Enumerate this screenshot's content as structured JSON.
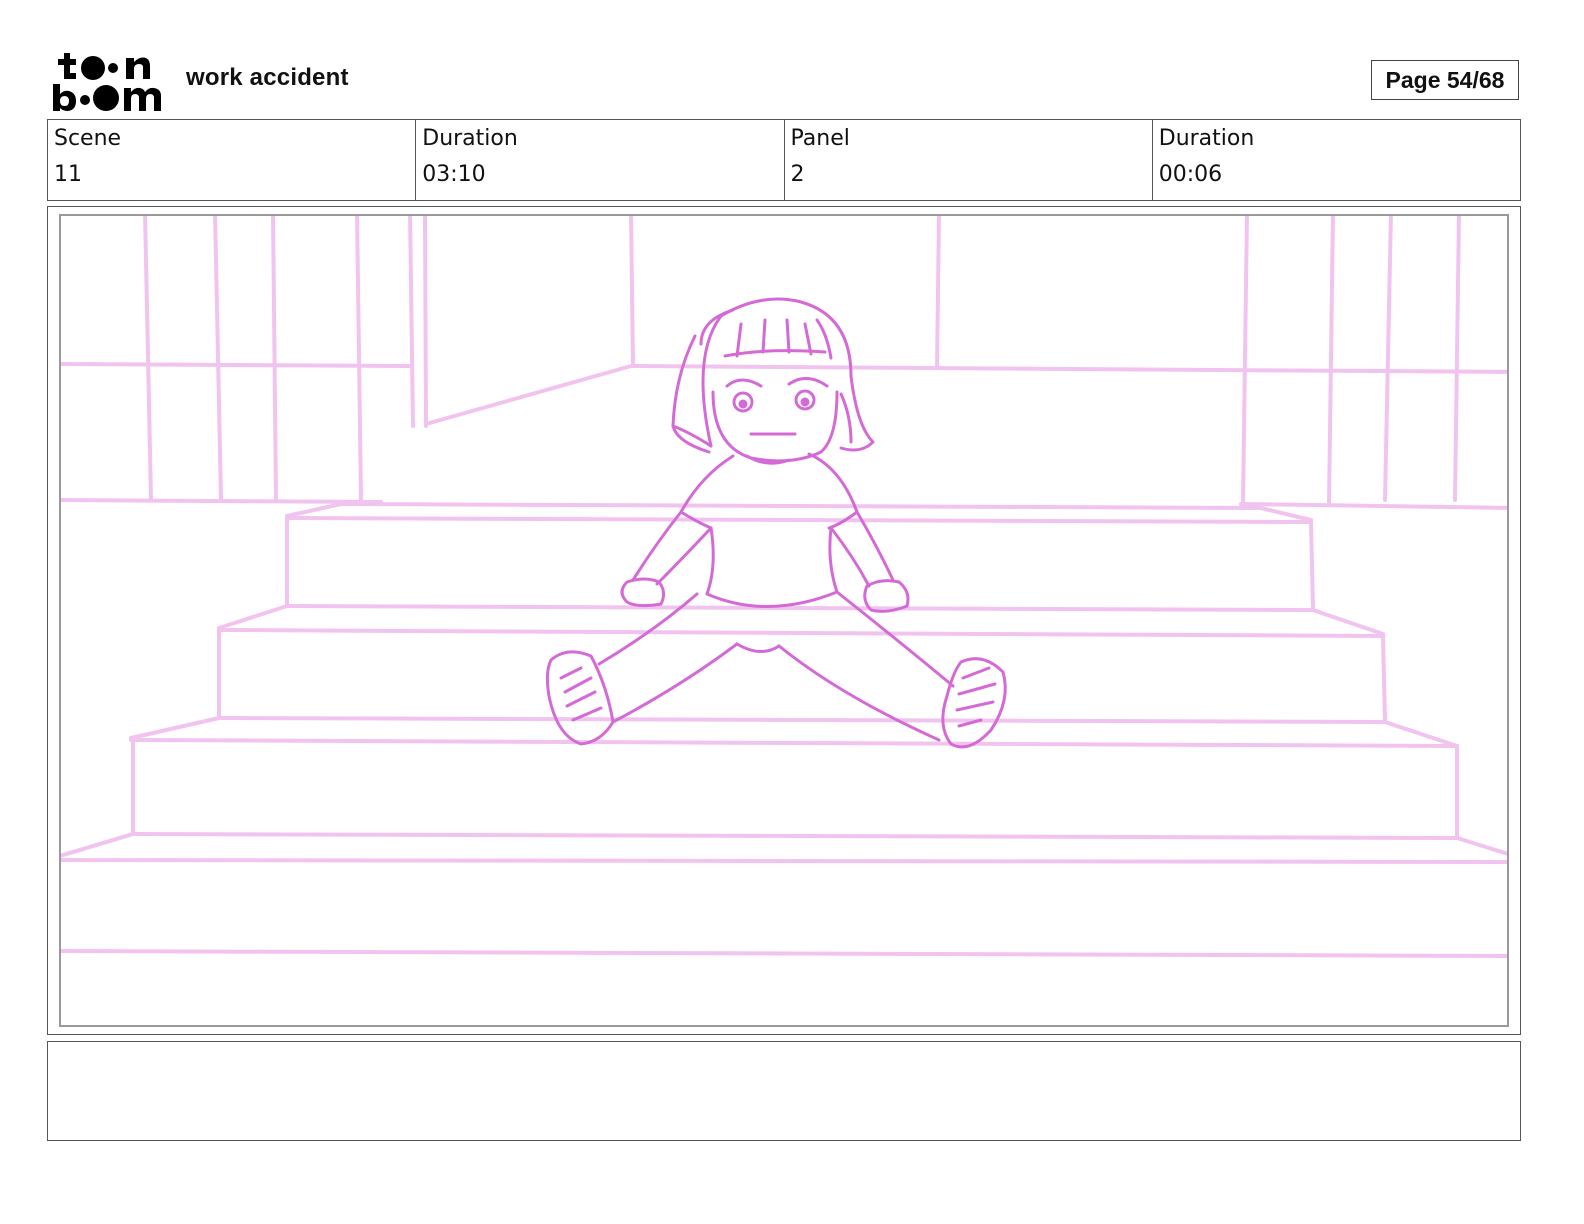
{
  "header": {
    "logo_text": "toonboom",
    "logo_line1": "toon",
    "logo_line2": "boom",
    "project_title": "work accident",
    "page_indicator": "Page 54/68"
  },
  "info": {
    "scene_label": "Scene",
    "scene_value": "11",
    "scene_duration_label": "Duration",
    "scene_duration_value": "03:10",
    "panel_label": "Panel",
    "panel_value": "2",
    "panel_duration_label": "Duration",
    "panel_duration_value": "00:06"
  },
  "panel": {
    "drawing": "sketch-girl-sitting-on-stairs",
    "line_color": "#d46ad6",
    "bg_line_color": "#f0c4ef"
  },
  "notes": {
    "text": ""
  }
}
